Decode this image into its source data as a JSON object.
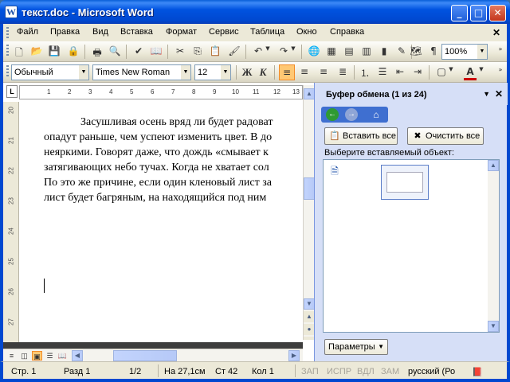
{
  "window": {
    "title": "текст.doc - Microsoft Word",
    "minimize": "_",
    "maximize": "□",
    "close": "✕"
  },
  "menu": {
    "items": [
      "Файл",
      "Правка",
      "Вид",
      "Вставка",
      "Формат",
      "Сервис",
      "Таблица",
      "Окно",
      "Справка"
    ],
    "close_doc": "✕"
  },
  "toolbar_standard": {
    "zoom": "100%"
  },
  "toolbar_format": {
    "style": "Обычный",
    "font": "Times New Roman",
    "size": "12",
    "bold": "Ж",
    "italic": "К",
    "underline_color": "#cc0000"
  },
  "ruler": {
    "box": "L",
    "h_ticks": [
      "1",
      "2",
      "3",
      "4",
      "5",
      "6",
      "7",
      "8",
      "9",
      "10",
      "11",
      "12",
      "13"
    ],
    "v_ticks": [
      "20",
      "21",
      "22",
      "23",
      "24",
      "25",
      "26",
      "27"
    ]
  },
  "document": {
    "lines": [
      "Засушливая осень вряд ли будет радоват",
      "опадут раньше, чем успеют изменить цвет. В до",
      "неяркими. Говорят даже, что дождь «смывает к",
      "затягивающих небо тучах. Когда не хватает сол",
      "По это же причине, если один кленовый лист за",
      "лист будет багряным, на находящийся под ним"
    ]
  },
  "taskpane": {
    "title": "Буфер обмена (1 из 24)",
    "paste_all": "Вставить все",
    "clear_all": "Очистить все",
    "select_label": "Выберите вставляемый объект:",
    "options": "Параметры"
  },
  "status": {
    "page": "Стр. 1",
    "section": "Разд 1",
    "pages": "1/2",
    "position": "На 27,1см",
    "line": "Ст 42",
    "column": "Кол 1",
    "rec": "ЗАП",
    "track": "ИСПР",
    "extend": "ВДЛ",
    "overtype": "ЗАМ",
    "language": "русский (Ро"
  },
  "colors": {
    "title_blue": "#0048d0",
    "active_button": "#ffc873",
    "taskpane_bg": "#d6dff7"
  }
}
